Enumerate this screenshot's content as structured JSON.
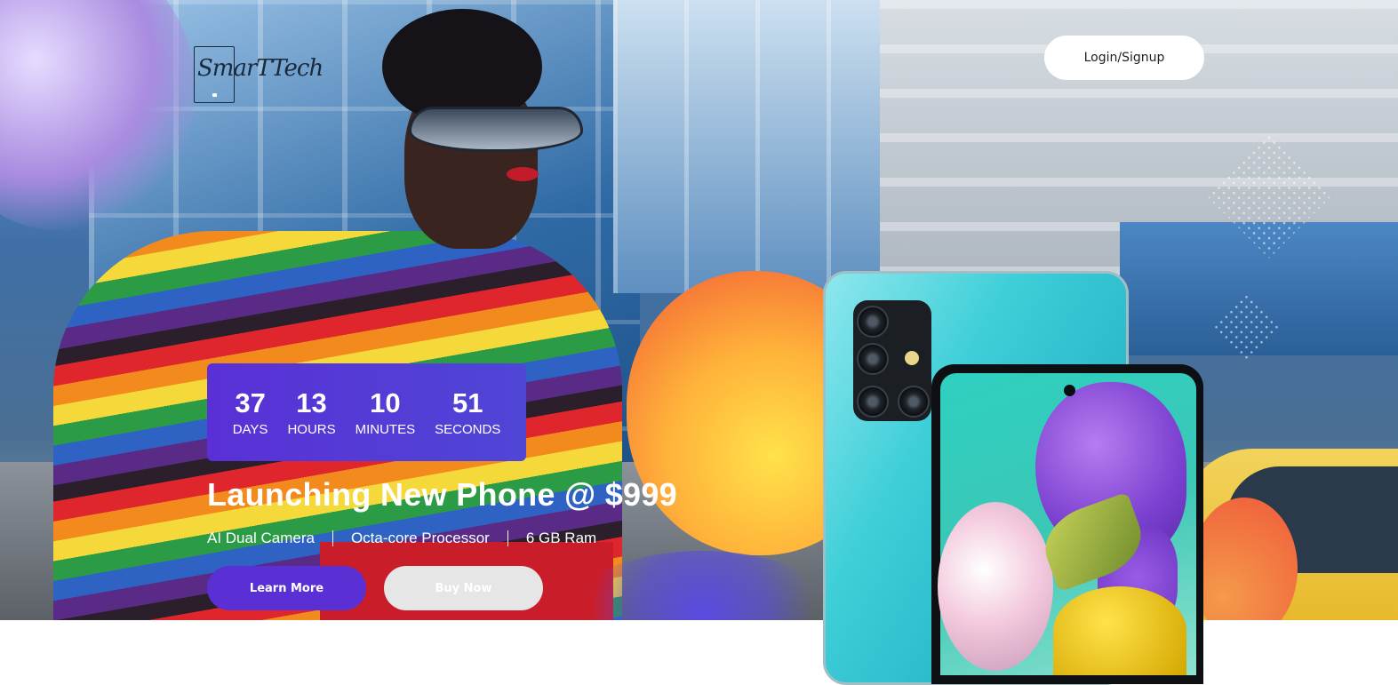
{
  "brand": {
    "logo_text": "SmarTTech"
  },
  "header": {
    "login_label": "Login/Signup"
  },
  "countdown": {
    "units": [
      {
        "value": "37",
        "label": "DAYS"
      },
      {
        "value": "13",
        "label": "HOURS"
      },
      {
        "value": "10",
        "label": "MINUTES"
      },
      {
        "value": "51",
        "label": "SECONDS"
      }
    ]
  },
  "hero": {
    "headline": "Launching New Phone @ $999",
    "features": [
      "AI Dual Camera",
      "Octa-core Processor",
      "6 GB Ram"
    ],
    "learn_more_label": "Learn More",
    "buy_now_label": "Buy Now"
  },
  "colors": {
    "accent_purple": "#5a2fd4",
    "countdown_bg": "#4f46d6",
    "buy_button_bg": "#e6e6e6"
  }
}
